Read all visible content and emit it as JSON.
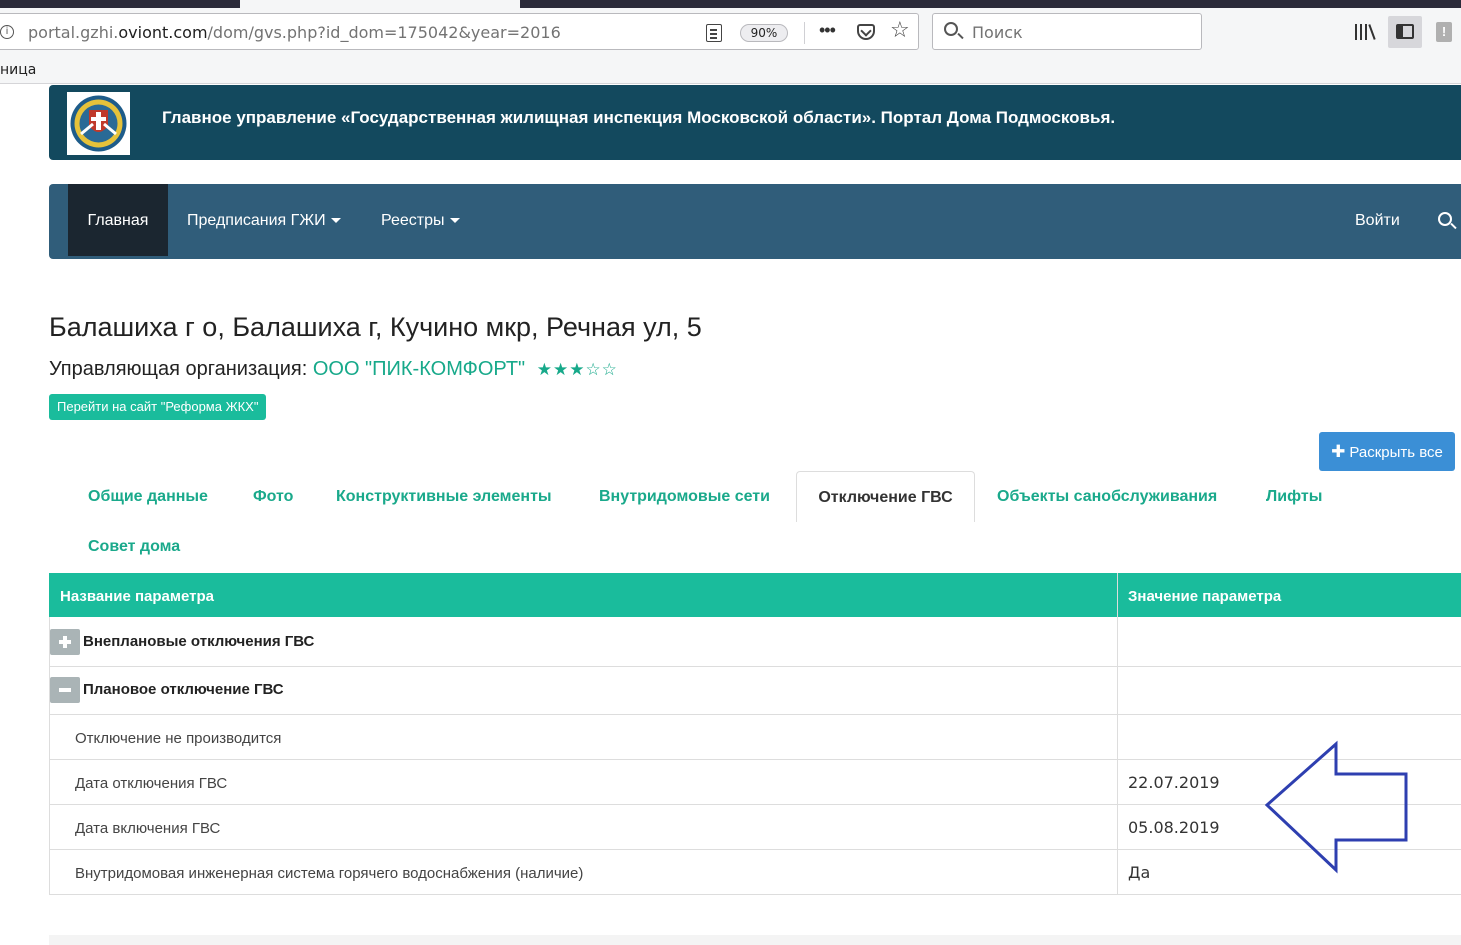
{
  "browser": {
    "url_prefix": "portal.gzhi.",
    "url_host": "oviont.com",
    "url_path": "/dom/gvs.php?id_dom=175042&year=2016",
    "zoom": "90%",
    "more": "•••",
    "search_placeholder": "Поиск",
    "bookmark_fragment": "ница"
  },
  "header": {
    "title": "Главное управление «Государственная жилищная инспекция Московской области». Портал Дома Подмосковья."
  },
  "nav": {
    "home": "Главная",
    "prescriptions": "Предписания ГЖИ",
    "registries": "Реестры",
    "login": "Войти"
  },
  "house": {
    "address": "Балашиха г о, Балашиха г, Кучино мкр, Речная ул, 5",
    "org_label": "Управляющая организация:",
    "org_name": "ООО \"ПИК-КОМФОРТ\"",
    "org_stars": "★★★☆☆",
    "rating": 3,
    "reform_button": "Перейти на сайт \"Реформа ЖКХ\"",
    "expand_all": "Раскрыть все"
  },
  "tabs": [
    {
      "label": "Общие данные"
    },
    {
      "label": "Фото"
    },
    {
      "label": "Конструктивные элементы"
    },
    {
      "label": "Внутридомовые сети"
    },
    {
      "label": "Отключение ГВС"
    },
    {
      "label": "Объекты санобслуживания"
    },
    {
      "label": "Лифты"
    },
    {
      "label": "Совет дома"
    }
  ],
  "table": {
    "col_param": "Название параметра",
    "col_value": "Значение параметра",
    "groups": [
      {
        "label": "Внеплановые отключения ГВС"
      },
      {
        "label": "Плановое отключение ГВС"
      }
    ],
    "rows": [
      {
        "param": "Отключение не производится",
        "value": ""
      },
      {
        "param": "Дата отключения ГВС",
        "value": "22.07.2019"
      },
      {
        "param": "Дата включения ГВС",
        "value": "05.08.2019"
      },
      {
        "param": "Внутридомовая инженерная система горячего водоснабжения (наличие)",
        "value": "Да"
      }
    ]
  },
  "colors": {
    "header_bg": "#13495e",
    "nav_bg": "#305d7a",
    "accent": "#1abc9c",
    "expand_button": "#3b8fd6",
    "annotation_arrow": "#2e3fb0"
  }
}
